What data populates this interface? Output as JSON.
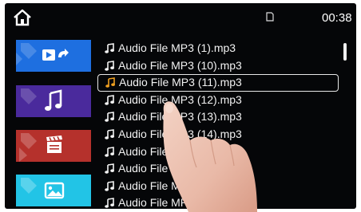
{
  "statusbar": {
    "time": "00:38",
    "home_icon": "home-icon",
    "sd_icon": "sd-card-icon"
  },
  "sidebar": {
    "tiles": [
      {
        "name": "video-playlist",
        "icon": "video-play-return-icon",
        "color": "#1e6fe0"
      },
      {
        "name": "music",
        "icon": "music-note-icon",
        "color": "#4a2a9c"
      },
      {
        "name": "movie",
        "icon": "clapperboard-icon",
        "color": "#b5312c"
      },
      {
        "name": "pictures",
        "icon": "picture-icon",
        "color": "#22c4e6"
      }
    ]
  },
  "files": [
    {
      "label": "Audio File MP3 (1).mp3"
    },
    {
      "label": "Audio File MP3 (10).mp3"
    },
    {
      "label": "Audio File MP3 (11).mp3",
      "selected": true
    },
    {
      "label": "Audio File MP3 (12).mp3"
    },
    {
      "label": "Audio File MP3 (13).mp3"
    },
    {
      "label": "Audio File MP3 (14).mp3"
    },
    {
      "label": "Audio File MP3 (15).mp3"
    },
    {
      "label": "Audio File MP3 (16).mp3"
    },
    {
      "label": "Audio File MP3 (17).mp3"
    },
    {
      "label": "Audio File MP3 (18).mp3"
    }
  ],
  "colors": {
    "background": "#050608",
    "text": "#f2f2f2",
    "selected_icon": "#f0a020"
  }
}
